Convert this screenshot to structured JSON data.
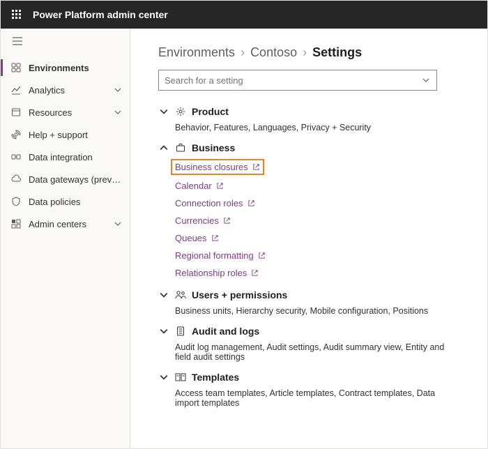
{
  "header": {
    "title": "Power Platform admin center"
  },
  "sidebar": {
    "items": [
      {
        "label": "Environments",
        "icon": "environments-icon",
        "active": true
      },
      {
        "label": "Analytics",
        "icon": "analytics-icon",
        "expandable": true
      },
      {
        "label": "Resources",
        "icon": "resources-icon",
        "expandable": true
      },
      {
        "label": "Help + support",
        "icon": "help-icon"
      },
      {
        "label": "Data integration",
        "icon": "data-integration-icon"
      },
      {
        "label": "Data gateways (preview)",
        "icon": "cloud-icon"
      },
      {
        "label": "Data policies",
        "icon": "shield-icon"
      },
      {
        "label": "Admin centers",
        "icon": "admin-centers-icon",
        "expandable": true
      }
    ]
  },
  "breadcrumb": {
    "l0": "Environments",
    "l1": "Contoso",
    "l2": "Settings"
  },
  "search": {
    "placeholder": "Search for a setting"
  },
  "sections": {
    "product": {
      "title": "Product",
      "desc": "Behavior, Features, Languages, Privacy + Security"
    },
    "business": {
      "title": "Business",
      "links": [
        {
          "label": "Business closures",
          "highlight": true
        },
        {
          "label": "Calendar"
        },
        {
          "label": "Connection roles"
        },
        {
          "label": "Currencies"
        },
        {
          "label": "Queues"
        },
        {
          "label": "Regional formatting"
        },
        {
          "label": "Relationship roles"
        }
      ]
    },
    "users": {
      "title": "Users + permissions",
      "desc": "Business units, Hierarchy security, Mobile configuration, Positions"
    },
    "audit": {
      "title": "Audit and logs",
      "desc": "Audit log management, Audit settings, Audit summary view, Entity and field audit settings"
    },
    "templates": {
      "title": "Templates",
      "desc": "Access team templates, Article templates, Contract templates, Data import templates"
    }
  }
}
